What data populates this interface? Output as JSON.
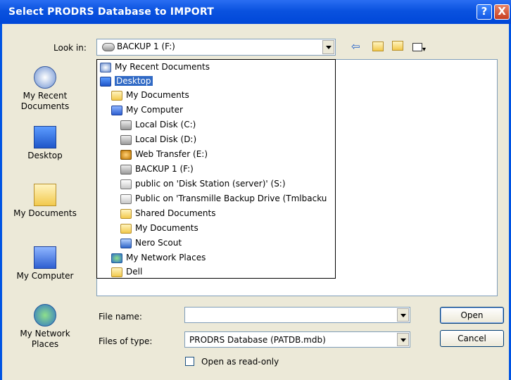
{
  "window": {
    "title": "Select PRODRS Database to IMPORT",
    "help_glyph": "?",
    "close_glyph": "X"
  },
  "lookin": {
    "label": "Look in:",
    "value": "BACKUP 1 (F:)"
  },
  "toolbar": {
    "back_icon": "back-arrow-icon",
    "up_icon": "up-folder-icon",
    "new_folder_icon": "new-folder-icon",
    "views_icon": "views-menu-icon"
  },
  "places": [
    {
      "label": "My Recent\nDocuments",
      "icon": "recent-documents-icon"
    },
    {
      "label": "Desktop",
      "icon": "desktop-icon"
    },
    {
      "label": "My Documents",
      "icon": "my-documents-icon"
    },
    {
      "label": "My Computer",
      "icon": "my-computer-icon"
    },
    {
      "label": "My Network\nPlaces",
      "icon": "network-places-icon"
    }
  ],
  "dropdown": {
    "items": [
      {
        "label": "My Recent Documents",
        "icon": "recent"
      },
      {
        "label": "Desktop",
        "icon": "desk",
        "selected": true
      },
      {
        "label": "My Documents",
        "icon": "folder"
      },
      {
        "label": "My Computer",
        "icon": "comp"
      },
      {
        "label": "Local Disk (C:)",
        "icon": "drive"
      },
      {
        "label": "Local Disk (D:)",
        "icon": "drive"
      },
      {
        "label": "Web Transfer (E:)",
        "icon": "web"
      },
      {
        "label": "BACKUP 1 (F:)",
        "icon": "drive"
      },
      {
        "label": "public on 'Disk Station (server)' (S:)",
        "icon": "share"
      },
      {
        "label": "Public on 'Transmille Backup Drive (Tmlbacku",
        "icon": "share"
      },
      {
        "label": "Shared Documents",
        "icon": "folder"
      },
      {
        "label": "My Documents",
        "icon": "folder"
      },
      {
        "label": "Nero Scout",
        "icon": "nero"
      },
      {
        "label": "My Network Places",
        "icon": "net"
      },
      {
        "label": "Dell",
        "icon": "folder"
      }
    ]
  },
  "filename": {
    "label": "File name:",
    "value": ""
  },
  "filetype": {
    "label": "Files of type:",
    "value": "PRODRS Database (PATDB.mdb)"
  },
  "readonly": {
    "label": "Open as read-only"
  },
  "buttons": {
    "open": "Open",
    "cancel": "Cancel"
  }
}
